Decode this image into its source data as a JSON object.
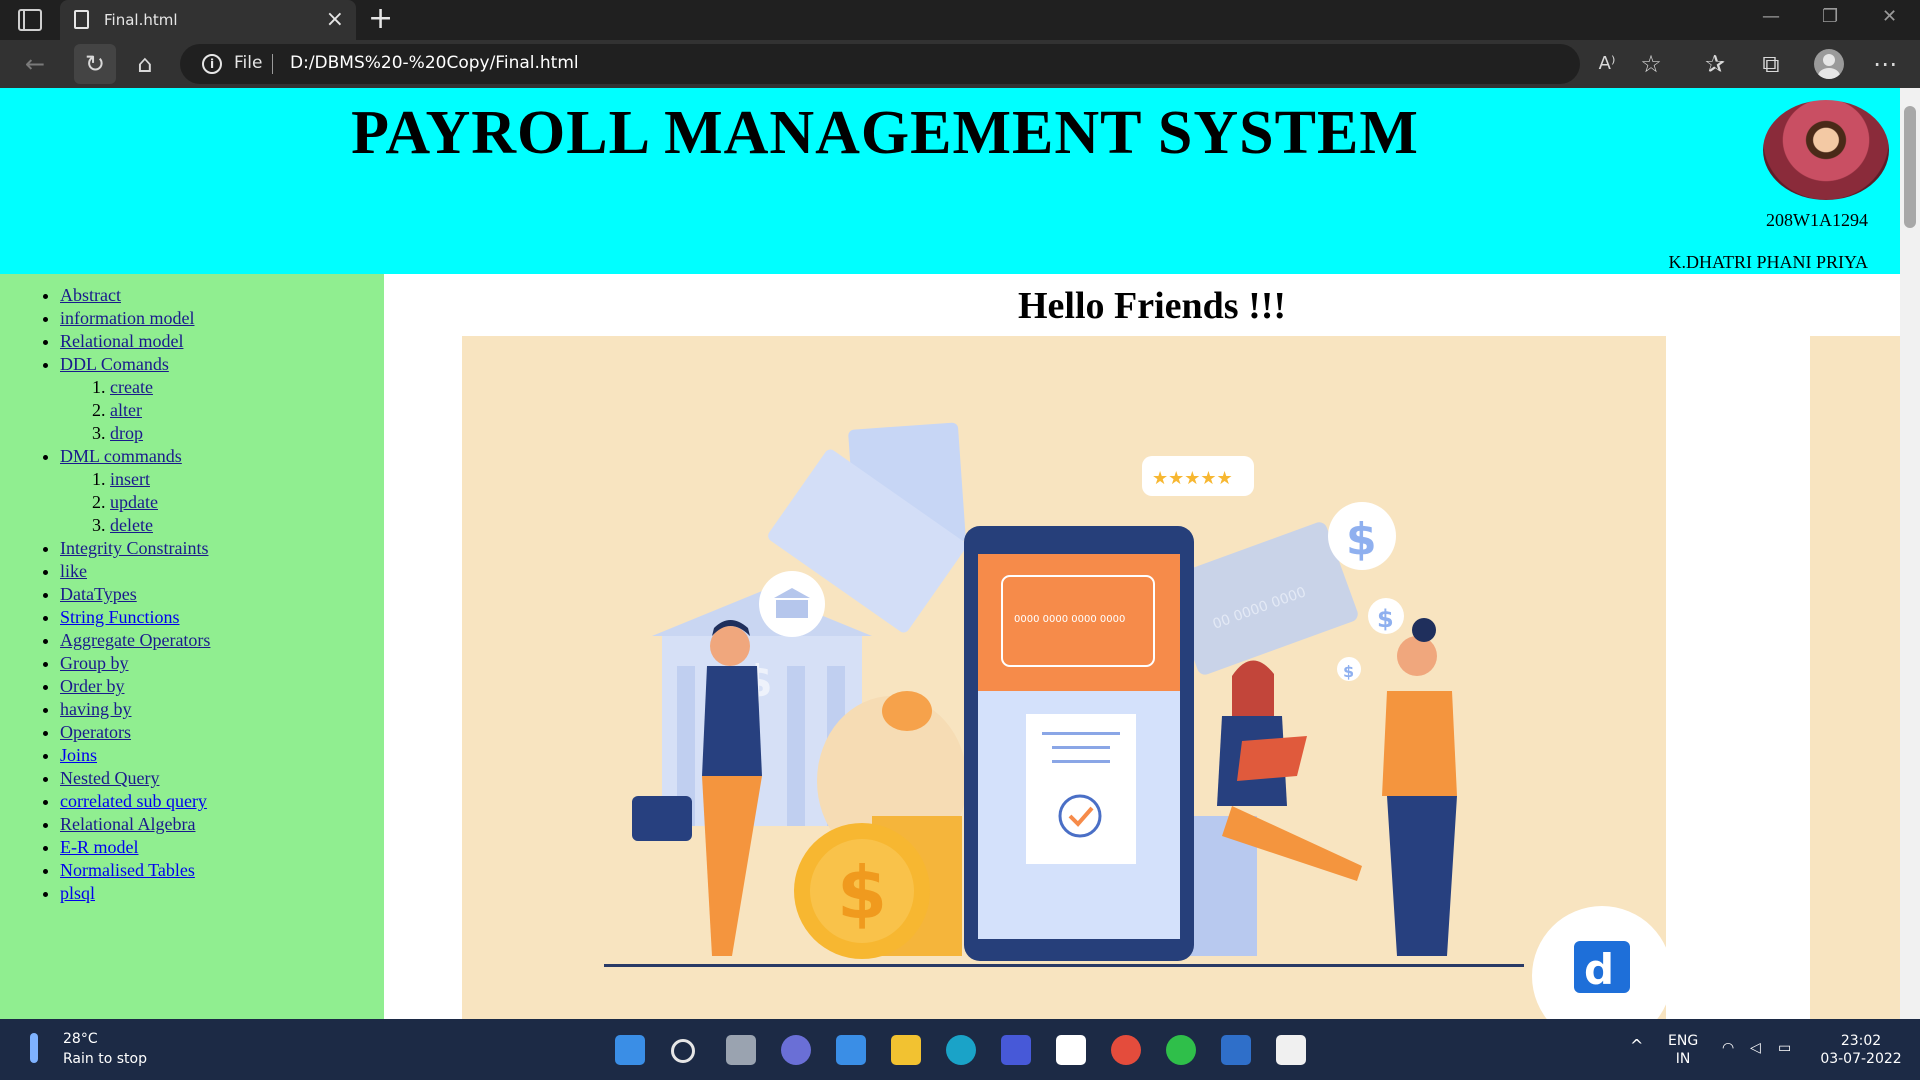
{
  "browser": {
    "tab_title": "Final.html",
    "address_scheme": "File",
    "url": "D:/DBMS%20-%20Copy/Final.html"
  },
  "page": {
    "title": "PAYROLL MANAGEMENT SYSTEM",
    "roll_number": "208W1A1294",
    "student_name": "K.DHATRI PHANI PRIYA",
    "greeting": "Hello Friends !!!"
  },
  "nav": [
    {
      "label": "Abstract"
    },
    {
      "label": "information model"
    },
    {
      "label": "Relational model"
    },
    {
      "label": "DDL Comands",
      "sub": [
        "create",
        "alter",
        "drop"
      ]
    },
    {
      "label": "DML commands",
      "sub": [
        "insert",
        "update",
        "delete"
      ]
    },
    {
      "label": "Integrity Constraints"
    },
    {
      "label": "like"
    },
    {
      "label": "DataTypes"
    },
    {
      "label": "String Functions"
    },
    {
      "label": "Aggregate Operators"
    },
    {
      "label": "Group by"
    },
    {
      "label": "Order by"
    },
    {
      "label": "having by"
    },
    {
      "label": "Operators"
    },
    {
      "label": "Joins"
    },
    {
      "label": "Nested Query"
    },
    {
      "label": "correlated sub query"
    },
    {
      "label": "Relational Algebra"
    },
    {
      "label": "E-R model"
    },
    {
      "label": "Normalised Tables"
    },
    {
      "label": "plsql"
    }
  ],
  "illustration": {
    "card_number": "0000 0000 0000 0000",
    "card_number_back": "00 0000 0000",
    "logo_letter": "d"
  },
  "taskbar": {
    "temperature": "28°C",
    "weather": "Rain to stop",
    "lang_1": "ENG",
    "lang_2": "IN",
    "time": "23:02",
    "date": "03-07-2022"
  },
  "colors": {
    "header_bg": "#00ffff",
    "sidebar_bg": "#90ee90",
    "illustration_bg": "#f8e4c0"
  }
}
